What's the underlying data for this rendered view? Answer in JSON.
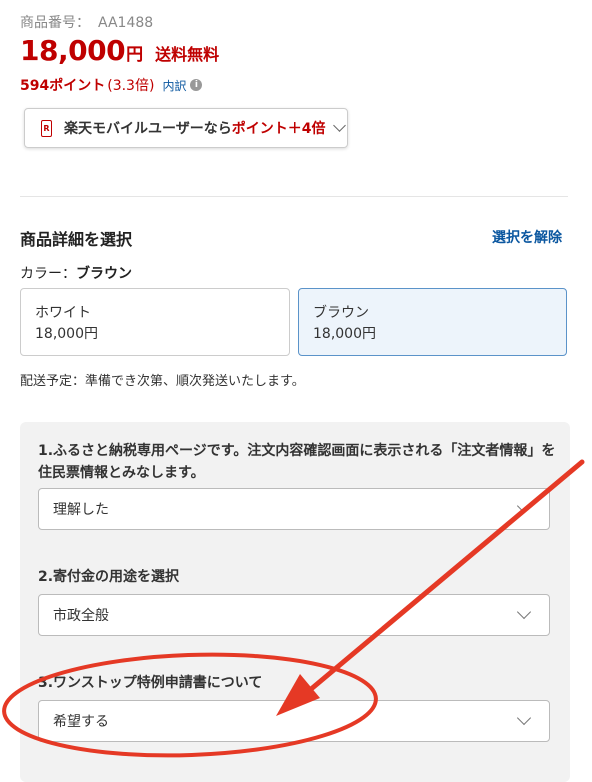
{
  "product": {
    "number_label": "商品番号：",
    "number_value": "AA1488",
    "price": "18,000",
    "yen": "円",
    "shipping": "送料無料",
    "points": "594ポイント",
    "points_rate": "(3.3倍)",
    "breakdown": "内訳",
    "info_glyph": "i"
  },
  "mobile_banner": {
    "icon_glyph": "R",
    "text": "楽天モバイルユーザーなら",
    "highlight": "ポイント＋4倍"
  },
  "details": {
    "title": "商品詳細を選択",
    "deselect": "選択を解除",
    "color_label": "カラー：",
    "color_selected": "ブラウン",
    "options": [
      {
        "name": "ホワイト",
        "price": "18,000円",
        "selected": false
      },
      {
        "name": "ブラウン",
        "price": "18,000円",
        "selected": true
      }
    ],
    "delivery": "配送予定：準備でき次第、順次発送いたします。"
  },
  "questions": [
    {
      "label": "1.ふるさと納税専用ページです。注文内容確認画面に表示される「注文者情報」を住民票情報とみなします。",
      "value": "理解した"
    },
    {
      "label": "2.寄付金の用途を選択",
      "value": "市政全般"
    },
    {
      "label": "3.ワンストップ特例申請書について",
      "value": "希望する"
    }
  ],
  "colors": {
    "brand_red": "#bf0000",
    "link_blue": "#0b57a0",
    "annotation_red": "#e53925"
  },
  "icons": {
    "info": "info-icon",
    "mobile": "rakuten-mobile-icon",
    "chevron": "chevron-down-icon"
  }
}
